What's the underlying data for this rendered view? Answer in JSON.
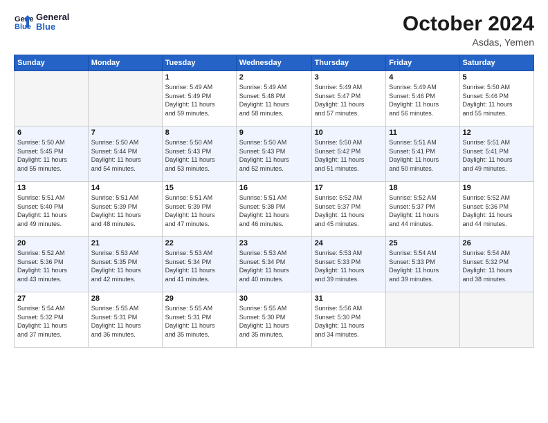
{
  "header": {
    "logo_line1": "General",
    "logo_line2": "Blue",
    "month_title": "October 2024",
    "location": "Asdas, Yemen"
  },
  "days_of_week": [
    "Sunday",
    "Monday",
    "Tuesday",
    "Wednesday",
    "Thursday",
    "Friday",
    "Saturday"
  ],
  "weeks": [
    [
      {
        "num": "",
        "info": ""
      },
      {
        "num": "",
        "info": ""
      },
      {
        "num": "1",
        "info": "Sunrise: 5:49 AM\nSunset: 5:49 PM\nDaylight: 11 hours\nand 59 minutes."
      },
      {
        "num": "2",
        "info": "Sunrise: 5:49 AM\nSunset: 5:48 PM\nDaylight: 11 hours\nand 58 minutes."
      },
      {
        "num": "3",
        "info": "Sunrise: 5:49 AM\nSunset: 5:47 PM\nDaylight: 11 hours\nand 57 minutes."
      },
      {
        "num": "4",
        "info": "Sunrise: 5:49 AM\nSunset: 5:46 PM\nDaylight: 11 hours\nand 56 minutes."
      },
      {
        "num": "5",
        "info": "Sunrise: 5:50 AM\nSunset: 5:46 PM\nDaylight: 11 hours\nand 55 minutes."
      }
    ],
    [
      {
        "num": "6",
        "info": "Sunrise: 5:50 AM\nSunset: 5:45 PM\nDaylight: 11 hours\nand 55 minutes."
      },
      {
        "num": "7",
        "info": "Sunrise: 5:50 AM\nSunset: 5:44 PM\nDaylight: 11 hours\nand 54 minutes."
      },
      {
        "num": "8",
        "info": "Sunrise: 5:50 AM\nSunset: 5:43 PM\nDaylight: 11 hours\nand 53 minutes."
      },
      {
        "num": "9",
        "info": "Sunrise: 5:50 AM\nSunset: 5:43 PM\nDaylight: 11 hours\nand 52 minutes."
      },
      {
        "num": "10",
        "info": "Sunrise: 5:50 AM\nSunset: 5:42 PM\nDaylight: 11 hours\nand 51 minutes."
      },
      {
        "num": "11",
        "info": "Sunrise: 5:51 AM\nSunset: 5:41 PM\nDaylight: 11 hours\nand 50 minutes."
      },
      {
        "num": "12",
        "info": "Sunrise: 5:51 AM\nSunset: 5:41 PM\nDaylight: 11 hours\nand 49 minutes."
      }
    ],
    [
      {
        "num": "13",
        "info": "Sunrise: 5:51 AM\nSunset: 5:40 PM\nDaylight: 11 hours\nand 49 minutes."
      },
      {
        "num": "14",
        "info": "Sunrise: 5:51 AM\nSunset: 5:39 PM\nDaylight: 11 hours\nand 48 minutes."
      },
      {
        "num": "15",
        "info": "Sunrise: 5:51 AM\nSunset: 5:39 PM\nDaylight: 11 hours\nand 47 minutes."
      },
      {
        "num": "16",
        "info": "Sunrise: 5:51 AM\nSunset: 5:38 PM\nDaylight: 11 hours\nand 46 minutes."
      },
      {
        "num": "17",
        "info": "Sunrise: 5:52 AM\nSunset: 5:37 PM\nDaylight: 11 hours\nand 45 minutes."
      },
      {
        "num": "18",
        "info": "Sunrise: 5:52 AM\nSunset: 5:37 PM\nDaylight: 11 hours\nand 44 minutes."
      },
      {
        "num": "19",
        "info": "Sunrise: 5:52 AM\nSunset: 5:36 PM\nDaylight: 11 hours\nand 44 minutes."
      }
    ],
    [
      {
        "num": "20",
        "info": "Sunrise: 5:52 AM\nSunset: 5:36 PM\nDaylight: 11 hours\nand 43 minutes."
      },
      {
        "num": "21",
        "info": "Sunrise: 5:53 AM\nSunset: 5:35 PM\nDaylight: 11 hours\nand 42 minutes."
      },
      {
        "num": "22",
        "info": "Sunrise: 5:53 AM\nSunset: 5:34 PM\nDaylight: 11 hours\nand 41 minutes."
      },
      {
        "num": "23",
        "info": "Sunrise: 5:53 AM\nSunset: 5:34 PM\nDaylight: 11 hours\nand 40 minutes."
      },
      {
        "num": "24",
        "info": "Sunrise: 5:53 AM\nSunset: 5:33 PM\nDaylight: 11 hours\nand 39 minutes."
      },
      {
        "num": "25",
        "info": "Sunrise: 5:54 AM\nSunset: 5:33 PM\nDaylight: 11 hours\nand 39 minutes."
      },
      {
        "num": "26",
        "info": "Sunrise: 5:54 AM\nSunset: 5:32 PM\nDaylight: 11 hours\nand 38 minutes."
      }
    ],
    [
      {
        "num": "27",
        "info": "Sunrise: 5:54 AM\nSunset: 5:32 PM\nDaylight: 11 hours\nand 37 minutes."
      },
      {
        "num": "28",
        "info": "Sunrise: 5:55 AM\nSunset: 5:31 PM\nDaylight: 11 hours\nand 36 minutes."
      },
      {
        "num": "29",
        "info": "Sunrise: 5:55 AM\nSunset: 5:31 PM\nDaylight: 11 hours\nand 35 minutes."
      },
      {
        "num": "30",
        "info": "Sunrise: 5:55 AM\nSunset: 5:30 PM\nDaylight: 11 hours\nand 35 minutes."
      },
      {
        "num": "31",
        "info": "Sunrise: 5:56 AM\nSunset: 5:30 PM\nDaylight: 11 hours\nand 34 minutes."
      },
      {
        "num": "",
        "info": ""
      },
      {
        "num": "",
        "info": ""
      }
    ]
  ]
}
